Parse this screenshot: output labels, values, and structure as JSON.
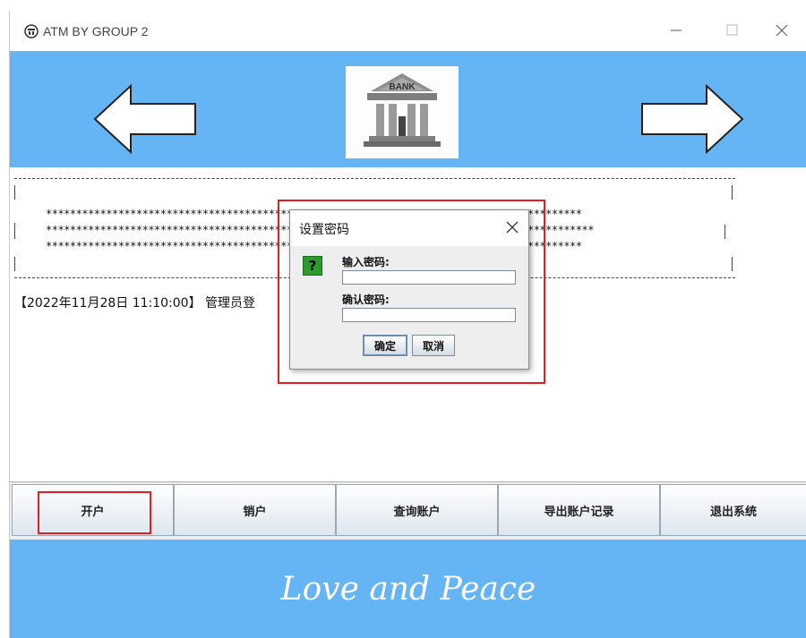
{
  "window": {
    "title": "ATM BY GROUP 2",
    "controls": [
      "minimize",
      "maximize",
      "close"
    ]
  },
  "banner": {
    "left_arrow": "left-arrow-icon",
    "right_arrow": "right-arrow-icon",
    "logo_text": "BANK"
  },
  "content": {
    "stars_line_1": "*****************************************************************************************",
    "stars_line_2": "*******************************************************************************************",
    "stars_line_3": "*****************************************************************************************",
    "status_line": "【2022年11月28日 11:10:00】 管理员登"
  },
  "buttons": [
    {
      "label": "开户"
    },
    {
      "label": "销户"
    },
    {
      "label": "查询账户"
    },
    {
      "label": "导出账户记录"
    },
    {
      "label": "退出系统"
    }
  ],
  "footer": {
    "slogan": "Love and Peace"
  },
  "dialog": {
    "title": "设置密码",
    "icon": "question-icon",
    "icon_text": "?",
    "password_label": "输入密码:",
    "password_value": "",
    "confirm_label": "确认密码:",
    "confirm_value": "",
    "ok_label": "确定",
    "cancel_label": "取消"
  },
  "colors": {
    "banner": "#65b4f3",
    "highlight": "#e02020",
    "question_icon": "#2e9a2e"
  }
}
